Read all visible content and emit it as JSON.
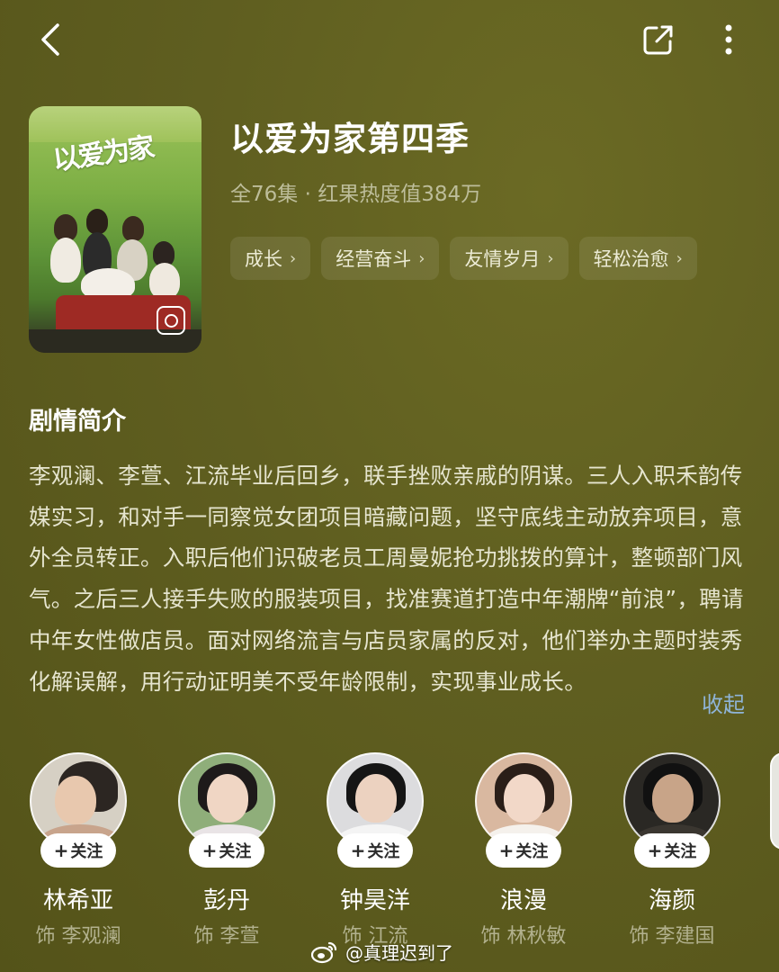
{
  "header": {
    "back_icon": "chevron-left-icon",
    "share_icon": "share-icon",
    "more_icon": "more-vertical-icon"
  },
  "show": {
    "title": "以爱为家第四季",
    "meta": "全76集 · 红果热度值384万",
    "tags": [
      {
        "label": "成长"
      },
      {
        "label": "经营奋斗"
      },
      {
        "label": "友情岁月"
      },
      {
        "label": "轻松治愈"
      }
    ],
    "poster": {
      "art_title": "以爱为家",
      "accent_colors": [
        "#9cc35a",
        "#9e2a24"
      ]
    }
  },
  "synopsis": {
    "heading": "剧情简介",
    "text": "李观澜、李萱、江流毕业后回乡，联手挫败亲戚的阴谋。三人入职禾韵传媒实习，和对手一同察觉女团项目暗藏问题，坚守底线主动放弃项目，意外全员转正。入职后他们识破老员工周曼妮抢功挑拨的算计，整顿部门风气。之后三人接手失败的服装项目，找准赛道打造中年潮牌“前浪”，聘请中年女性做店员。面对网络流言与店员家属的反对，他们举办主题时装秀化解误解，用行动证明美不受年龄限制，实现事业成长。",
    "collapse_label": "收起"
  },
  "cast": [
    {
      "name": "林希亚",
      "role": "饰 李观澜",
      "follow": "关注"
    },
    {
      "name": "彭丹",
      "role": "饰 李萱",
      "follow": "关注"
    },
    {
      "name": "钟昊洋",
      "role": "饰 江流",
      "follow": "关注"
    },
    {
      "name": "浪漫",
      "role": "饰 林秋敏",
      "follow": "关注"
    },
    {
      "name": "海颜",
      "role": "饰 李建国",
      "follow": "关注"
    }
  ],
  "watermark": {
    "text": "@真理迟到了",
    "icon": "weibo-icon"
  },
  "colors": {
    "background": "#5f5e20",
    "link": "#8fb4d8"
  }
}
